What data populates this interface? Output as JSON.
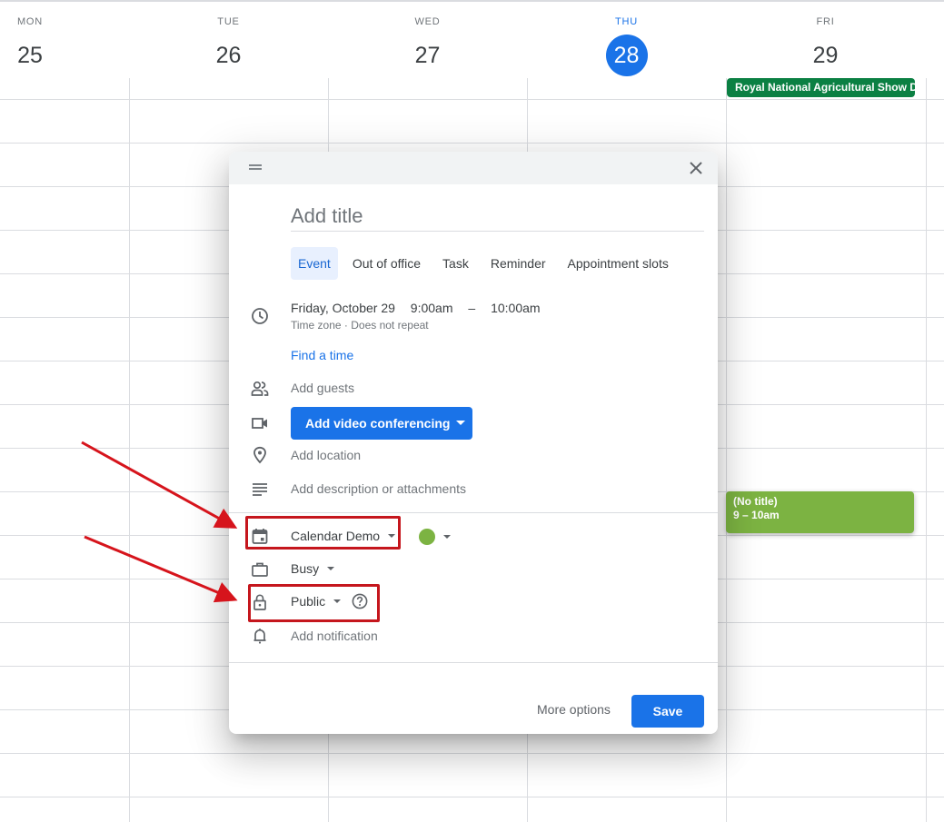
{
  "calendar": {
    "days": [
      {
        "dow": "MON",
        "num": "25"
      },
      {
        "dow": "TUE",
        "num": "26"
      },
      {
        "dow": "WED",
        "num": "27"
      },
      {
        "dow": "THU",
        "num": "28",
        "today": true
      },
      {
        "dow": "FRI",
        "num": "29"
      }
    ],
    "allday_event": "Royal National Agricultural Show Da",
    "timed_event": {
      "title": "(No title)",
      "time": "9 – 10am"
    },
    "colors": {
      "today": "#1a73e8",
      "allday_event": "#0b8043",
      "timed_event": "#7cb342"
    }
  },
  "dialog": {
    "title_placeholder": "Add title",
    "tabs": [
      "Event",
      "Out of office",
      "Task",
      "Reminder",
      "Appointment slots"
    ],
    "active_tab": "Event",
    "date": "Friday, October 29",
    "start_time": "9:00am",
    "dash": "–",
    "end_time": "10:00am",
    "subline": "Time zone · Does not repeat",
    "find_time": "Find a time",
    "add_guests": "Add guests",
    "video_button": "Add video conferencing",
    "add_location": "Add location",
    "add_description": "Add description or attachments",
    "calendar_select": "Calendar Demo",
    "event_color": "#7cb342",
    "availability": "Busy",
    "visibility": "Public",
    "add_notification": "Add notification",
    "more_options": "More options",
    "save": "Save"
  },
  "annotations": {
    "color": "#c5161d",
    "highlighted": [
      "calendar-select",
      "visibility-select"
    ]
  }
}
